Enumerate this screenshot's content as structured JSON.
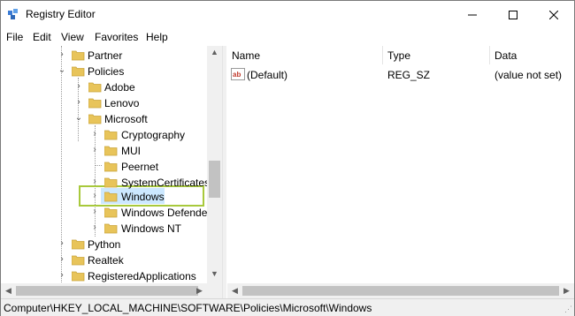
{
  "titlebar": {
    "title": "Registry Editor",
    "minimize_icon": "minimize-icon",
    "maximize_icon": "maximize-icon",
    "close_icon": "close-icon"
  },
  "menu": [
    "File",
    "Edit",
    "View",
    "Favorites",
    "Help"
  ],
  "tree": {
    "items": [
      {
        "label": "Partner",
        "expander": "collapsed"
      },
      {
        "label": "Policies",
        "expander": "expanded"
      },
      {
        "label": "Adobe",
        "expander": "collapsed"
      },
      {
        "label": "Lenovo",
        "expander": "collapsed"
      },
      {
        "label": "Microsoft",
        "expander": "expanded"
      },
      {
        "label": "Cryptography",
        "expander": "collapsed"
      },
      {
        "label": "MUI",
        "expander": "collapsed"
      },
      {
        "label": "Peernet",
        "expander": "none"
      },
      {
        "label": "SystemCertificates",
        "expander": "collapsed"
      },
      {
        "label": "Windows",
        "expander": "collapsed",
        "selected": true
      },
      {
        "label": "Windows Defender",
        "expander": "collapsed"
      },
      {
        "label": "Windows NT",
        "expander": "collapsed"
      },
      {
        "label": "Python",
        "expander": "collapsed"
      },
      {
        "label": "Realtek",
        "expander": "collapsed"
      },
      {
        "label": "RegisteredApplications",
        "expander": "collapsed"
      }
    ]
  },
  "values_pane": {
    "columns": [
      "Name",
      "Type",
      "Data"
    ],
    "rows": [
      {
        "name": "(Default)",
        "type": "REG_SZ",
        "data": "(value not set)",
        "icon": "string-value-icon"
      }
    ]
  },
  "statusbar": {
    "path": "Computer\\HKEY_LOCAL_MACHINE\\SOFTWARE\\Policies\\Microsoft\\Windows"
  },
  "colors": {
    "selection": "#cce8ff",
    "highlight_box": "#a8c93c",
    "folder": "#e8c45a"
  }
}
